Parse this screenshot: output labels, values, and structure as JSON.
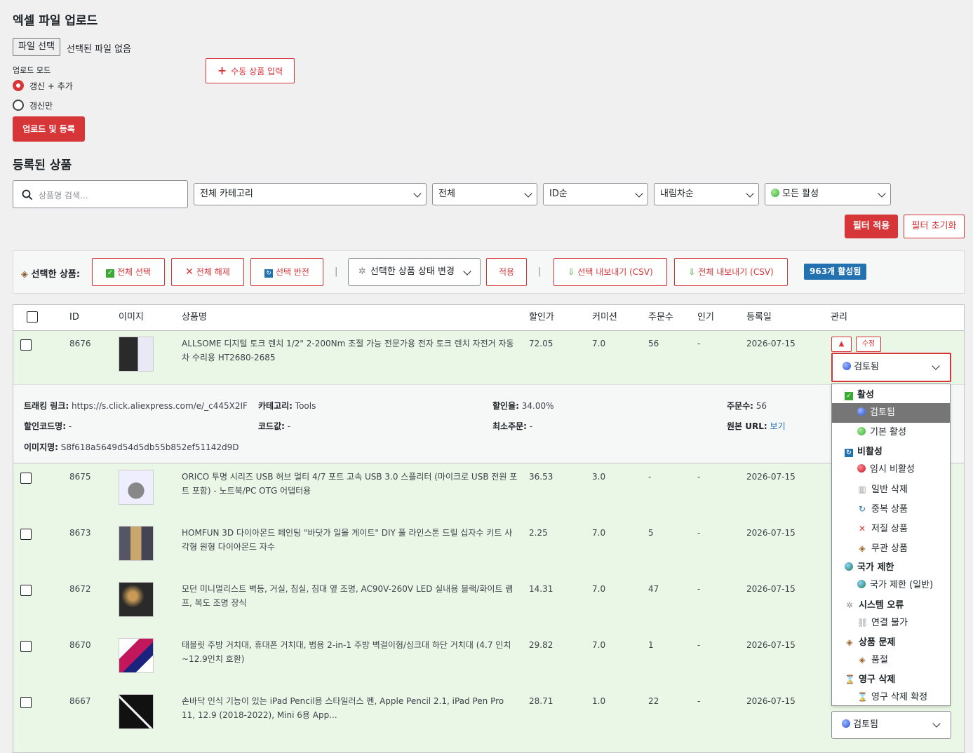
{
  "upload": {
    "heading": "엑셀 파일 업로드",
    "file_button": "파일 선택",
    "file_status": "선택된 파일 없음",
    "mode_label": "업로드 모드",
    "mode_options": [
      "갱신 + 추가",
      "갱신만"
    ],
    "manual_button": "수동 상품 입력",
    "submit_button": "업로드 및 등록"
  },
  "products": {
    "heading": "등록된 상품",
    "search_placeholder": "상품명 검색...",
    "filters": {
      "category": "전체 카테고리",
      "type": "전체",
      "sort": "ID순",
      "order": "내림차순",
      "activity": "모든 활성"
    },
    "apply_filter": "필터 적용",
    "reset_filter": "필터 초기화"
  },
  "bulk": {
    "label": "선택한 상품:",
    "select_all": "전체 선택",
    "deselect_all": "전체 해제",
    "invert": "선택 반전",
    "status_change": "선택한 상품 상태 변경",
    "apply": "적용",
    "export_selected": "선택 내보내기 (CSV)",
    "export_all": "전체 내보내기 (CSV)",
    "active_count": "963개 활성됨",
    "separator": "|"
  },
  "table": {
    "headers": [
      "ID",
      "이미지",
      "상품명",
      "할인가",
      "커미션",
      "주문수",
      "인기",
      "등록일",
      "관리"
    ],
    "rows": [
      {
        "id": "8676",
        "name": "ALLSOME 디지털 토크 렌치 1/2\" 2-200Nm 조절 가능 전문가용 전자 토크 렌치 자전거 자동차 수리용 HT2680-2685",
        "price": "72.05",
        "commission": "7.0",
        "orders": "56",
        "popular": "-",
        "date": "2026-07-15"
      },
      {
        "id": "8675",
        "name": "ORICO 투명 시리즈 USB 허브 멀티 4/7 포트 고속 USB 3.0 스플리터 (마이크로 USB 전원 포트 포함) - 노트북/PC OTG 어댑터용",
        "price": "36.53",
        "commission": "3.0",
        "orders": "-",
        "popular": "-",
        "date": "2026-07-15"
      },
      {
        "id": "8673",
        "name": "HOMFUN 3D 다이아몬드 페인팅 \"바닷가 일몰 게이트\" DIY 풀 라인스톤 드릴 십자수 키트 사각형 원형 다이아몬드 자수",
        "price": "2.25",
        "commission": "7.0",
        "orders": "5",
        "popular": "-",
        "date": "2026-07-15"
      },
      {
        "id": "8672",
        "name": "모던 미니멀리스트 벽등, 거실, 침실, 침대 옆 조명, AC90V-260V LED 실내용 블랙/화이트 램프, 복도 조명 장식",
        "price": "14.31",
        "commission": "7.0",
        "orders": "47",
        "popular": "-",
        "date": "2026-07-15"
      },
      {
        "id": "8670",
        "name": "태블릿 주방 거치대, 휴대폰 거치대, 범용 2-in-1 주방 벽걸이형/싱크대 하단 거치대 (4.7 인치~12.9인치 호환)",
        "price": "29.82",
        "commission": "7.0",
        "orders": "1",
        "popular": "-",
        "date": "2026-07-15"
      },
      {
        "id": "8667",
        "name": "손바닥 인식 기능이 있는 iPad Pencil용 스타일러스 펜, Apple Pencil 2.1, iPad Pen Pro 11, 12.9 (2018-2022), Mini 6용 App...",
        "price": "28.71",
        "commission": "1.0",
        "orders": "22",
        "popular": "-",
        "date": "2026-07-15"
      }
    ],
    "edit_label": "수정",
    "up_label": "▲",
    "status_value": "검토됨"
  },
  "details": {
    "tracking_label": "트래킹 링크:",
    "tracking_value": "https://s.click.aliexpress.com/e/_c445X2IF",
    "category_label": "카테고리:",
    "category_value": "Tools",
    "discount_label": "할인율:",
    "discount_value": "34.00%",
    "orders_label": "주문수:",
    "orders_value": "56",
    "coupon_label": "할인코드명:",
    "coupon_value": "-",
    "code_label": "코드값:",
    "code_value": "-",
    "min_label": "최소주문:",
    "min_value": "-",
    "origin_label": "원본 URL:",
    "origin_value": "보기",
    "image_label": "이미지명:",
    "image_value": "S8f618a5649d54d5db55b852ef51142d9D"
  },
  "status_menu": {
    "groups": [
      {
        "label": "활성",
        "icon": "check-box-icon",
        "options": [
          {
            "label": "검토됨",
            "icon": "blue-dot-icon"
          },
          {
            "label": "기본 활성",
            "icon": "green-dot-icon"
          }
        ]
      },
      {
        "label": "비활성",
        "icon": "refresh-box-icon",
        "options": [
          {
            "label": "임시 비활성",
            "icon": "red-dot-icon"
          },
          {
            "label": "일반 삭제",
            "icon": "trash-icon"
          },
          {
            "label": "중복 상품",
            "icon": "refresh-icon"
          },
          {
            "label": "저질 상품",
            "icon": "cross-icon"
          },
          {
            "label": "무관 상품",
            "icon": "box-icon"
          }
        ]
      },
      {
        "label": "국가 제한",
        "icon": "globe-icon",
        "options": [
          {
            "label": "국가 제한 (일반)",
            "icon": "globe-icon"
          }
        ]
      },
      {
        "label": "시스템 오류",
        "icon": "gear-icon",
        "options": [
          {
            "label": "연결 불가",
            "icon": "link-icon"
          }
        ]
      },
      {
        "label": "상품 문제",
        "icon": "box-icon",
        "options": [
          {
            "label": "품절",
            "icon": "box-icon"
          }
        ]
      },
      {
        "label": "영구 삭제",
        "icon": "hourglass-icon",
        "options": [
          {
            "label": "영구 삭제 확정",
            "icon": "hourglass-icon"
          }
        ]
      }
    ]
  },
  "colors": {
    "primary": "#d63638",
    "blue": "#2271b1",
    "row_bg": "#eaf7e6"
  }
}
